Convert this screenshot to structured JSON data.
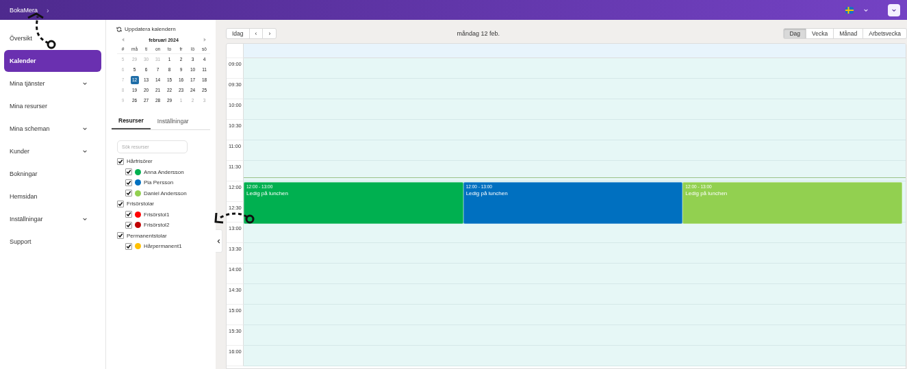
{
  "app": {
    "brand": "BokaMera",
    "breadcrumb_icon": "›"
  },
  "sidebar": {
    "items": [
      {
        "label": "Översikt",
        "selected": false,
        "expandable": false
      },
      {
        "label": "Kalender",
        "selected": true,
        "expandable": false
      },
      {
        "label": "Mina tjänster",
        "selected": false,
        "expandable": true
      },
      {
        "label": "Mina resurser",
        "selected": false,
        "expandable": false
      },
      {
        "label": "Mina scheman",
        "selected": false,
        "expandable": true
      },
      {
        "label": "Kunder",
        "selected": false,
        "expandable": true
      },
      {
        "label": "Bokningar",
        "selected": false,
        "expandable": false
      },
      {
        "label": "Hemsidan",
        "selected": false,
        "expandable": false
      },
      {
        "label": "Inställningar",
        "selected": false,
        "expandable": true
      },
      {
        "label": "Support",
        "selected": false,
        "expandable": false
      }
    ]
  },
  "mini_calendar": {
    "refresh_label": "Uppdatera kalendern",
    "month": "februari 2024",
    "weekday_headers": [
      "#",
      "må",
      "ti",
      "on",
      "to",
      "fr",
      "lö",
      "sö"
    ],
    "weeks": [
      {
        "week": "5",
        "days": [
          {
            "label": "29",
            "muted": true,
            "selected": false
          },
          {
            "label": "30",
            "muted": true,
            "selected": false
          },
          {
            "label": "31",
            "muted": true,
            "selected": false
          },
          {
            "label": "1",
            "muted": false,
            "selected": false
          },
          {
            "label": "2",
            "muted": false,
            "selected": false
          },
          {
            "label": "3",
            "muted": false,
            "selected": false
          },
          {
            "label": "4",
            "muted": false,
            "selected": false
          }
        ]
      },
      {
        "week": "6",
        "days": [
          {
            "label": "5",
            "muted": false,
            "selected": false
          },
          {
            "label": "6",
            "muted": false,
            "selected": false
          },
          {
            "label": "7",
            "muted": false,
            "selected": false
          },
          {
            "label": "8",
            "muted": false,
            "selected": false
          },
          {
            "label": "9",
            "muted": false,
            "selected": false
          },
          {
            "label": "10",
            "muted": false,
            "selected": false
          },
          {
            "label": "11",
            "muted": false,
            "selected": false
          }
        ]
      },
      {
        "week": "7",
        "days": [
          {
            "label": "12",
            "muted": false,
            "selected": true
          },
          {
            "label": "13",
            "muted": false,
            "selected": false
          },
          {
            "label": "14",
            "muted": false,
            "selected": false
          },
          {
            "label": "15",
            "muted": false,
            "selected": false
          },
          {
            "label": "16",
            "muted": false,
            "selected": false
          },
          {
            "label": "17",
            "muted": false,
            "selected": false
          },
          {
            "label": "18",
            "muted": false,
            "selected": false
          }
        ]
      },
      {
        "week": "8",
        "days": [
          {
            "label": "19",
            "muted": false,
            "selected": false
          },
          {
            "label": "20",
            "muted": false,
            "selected": false
          },
          {
            "label": "21",
            "muted": false,
            "selected": false
          },
          {
            "label": "22",
            "muted": false,
            "selected": false
          },
          {
            "label": "23",
            "muted": false,
            "selected": false
          },
          {
            "label": "24",
            "muted": false,
            "selected": false
          },
          {
            "label": "25",
            "muted": false,
            "selected": false
          }
        ]
      },
      {
        "week": "9",
        "days": [
          {
            "label": "26",
            "muted": false,
            "selected": false
          },
          {
            "label": "27",
            "muted": false,
            "selected": false
          },
          {
            "label": "28",
            "muted": false,
            "selected": false
          },
          {
            "label": "29",
            "muted": false,
            "selected": false
          },
          {
            "label": "1",
            "muted": true,
            "selected": false
          },
          {
            "label": "2",
            "muted": true,
            "selected": false
          },
          {
            "label": "3",
            "muted": true,
            "selected": false
          }
        ]
      }
    ]
  },
  "panel_tabs": [
    {
      "label": "Resurser",
      "selected": true
    },
    {
      "label": "Inställningar",
      "selected": false
    }
  ],
  "resource_search": {
    "placeholder": "Sök resurser"
  },
  "resource_groups": [
    {
      "label": "Hårfrisörer",
      "checked": true,
      "children": [
        {
          "label": "Anna Andersson",
          "checked": true,
          "color": "#00b050"
        },
        {
          "label": "Pia Persson",
          "checked": true,
          "color": "#0070c0"
        },
        {
          "label": "Daniel Andersson",
          "checked": true,
          "color": "#92d050"
        }
      ]
    },
    {
      "label": "Frisörstolar",
      "checked": true,
      "children": [
        {
          "label": "Frisörstol1",
          "checked": true,
          "color": "#ff0000"
        },
        {
          "label": "Frisörstol2",
          "checked": true,
          "color": "#c00000"
        }
      ]
    },
    {
      "label": "Permanentstolar",
      "checked": true,
      "children": [
        {
          "label": "Hårpermanent1",
          "checked": true,
          "color": "#ffc000"
        }
      ]
    }
  ],
  "toolbar": {
    "today": "Idag",
    "prev": "‹",
    "next": "›",
    "title": "måndag 12 feb.",
    "views": [
      {
        "label": "Dag",
        "selected": true
      },
      {
        "label": "Vecka",
        "selected": false
      },
      {
        "label": "Månad",
        "selected": false
      },
      {
        "label": "Arbetsvecka",
        "selected": false
      }
    ]
  },
  "time_slots": [
    "09:00",
    "09:30",
    "10:00",
    "10:30",
    "11:00",
    "11:30",
    "12:00",
    "12:30",
    "13:00",
    "13:30",
    "14:00",
    "14:30",
    "15:00",
    "15:30",
    "16:00"
  ],
  "events": [
    {
      "time": "12:00 - 13:00",
      "title": "Ledig på lunchen",
      "color": "#00b050"
    },
    {
      "time": "12:00 - 13:00",
      "title": "Ledig på lunchen",
      "color": "#0070c0"
    },
    {
      "time": "12:00 - 13:00",
      "title": "Ledig på lunchen",
      "color": "#92d050"
    }
  ]
}
